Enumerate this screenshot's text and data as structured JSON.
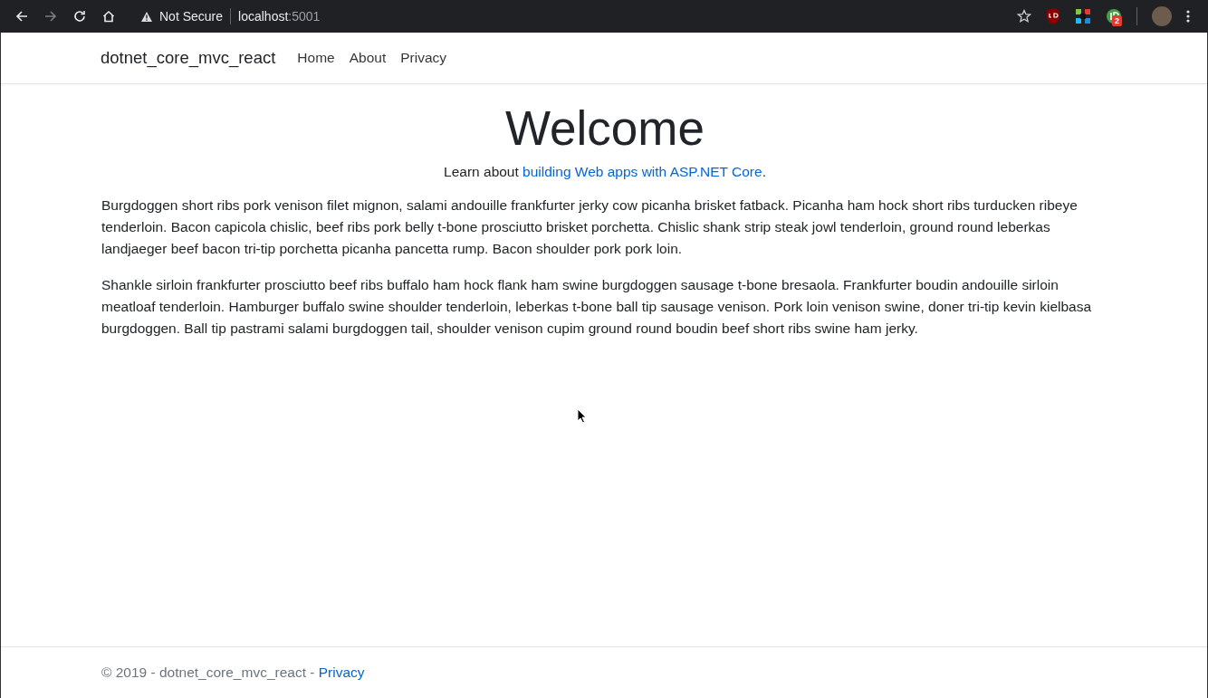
{
  "browser": {
    "nav_buttons": [
      {
        "kind": "back",
        "disabled": false
      },
      {
        "kind": "forward",
        "disabled": true
      },
      {
        "kind": "reload",
        "disabled": false
      },
      {
        "kind": "home",
        "disabled": false
      }
    ],
    "security": "Not Secure",
    "url_host": "localhost",
    "url_port": ":5001",
    "extension_badge": "2"
  },
  "navbar": {
    "brand": "dotnet_core_mvc_react",
    "links": [
      "Home",
      "About",
      "Privacy"
    ]
  },
  "main": {
    "heading": "Welcome",
    "lead": {
      "prefix": "Learn about ",
      "link": "building Web apps with ASP.NET Core",
      "suffix": "."
    },
    "paragraphs": [
      "Burgdoggen short ribs pork venison filet mignon, salami andouille frankfurter jerky cow picanha brisket fatback. Picanha ham hock short ribs turducken ribeye tenderloin. Bacon capicola chislic, beef ribs pork belly t-bone prosciutto brisket porchetta. Chislic shank strip steak jowl tenderloin, ground round leberkas landjaeger beef bacon tri-tip porchetta picanha pancetta rump. Bacon shoulder pork pork loin.",
      "Shankle sirloin frankfurter prosciutto beef ribs buffalo ham hock flank ham swine burgdoggen sausage t-bone bresaola. Frankfurter boudin andouille sirloin meatloaf tenderloin. Hamburger buffalo swine shoulder tenderloin, leberkas t-bone ball tip sausage venison. Pork loin venison swine, doner tri-tip kevin kielbasa burgdoggen. Ball tip pastrami salami burgdoggen tail, shoulder venison cupim ground round boudin beef short ribs swine ham jerky."
    ]
  },
  "footer": {
    "text": "© 2019 - dotnet_core_mvc_react - ",
    "link": "Privacy"
  }
}
